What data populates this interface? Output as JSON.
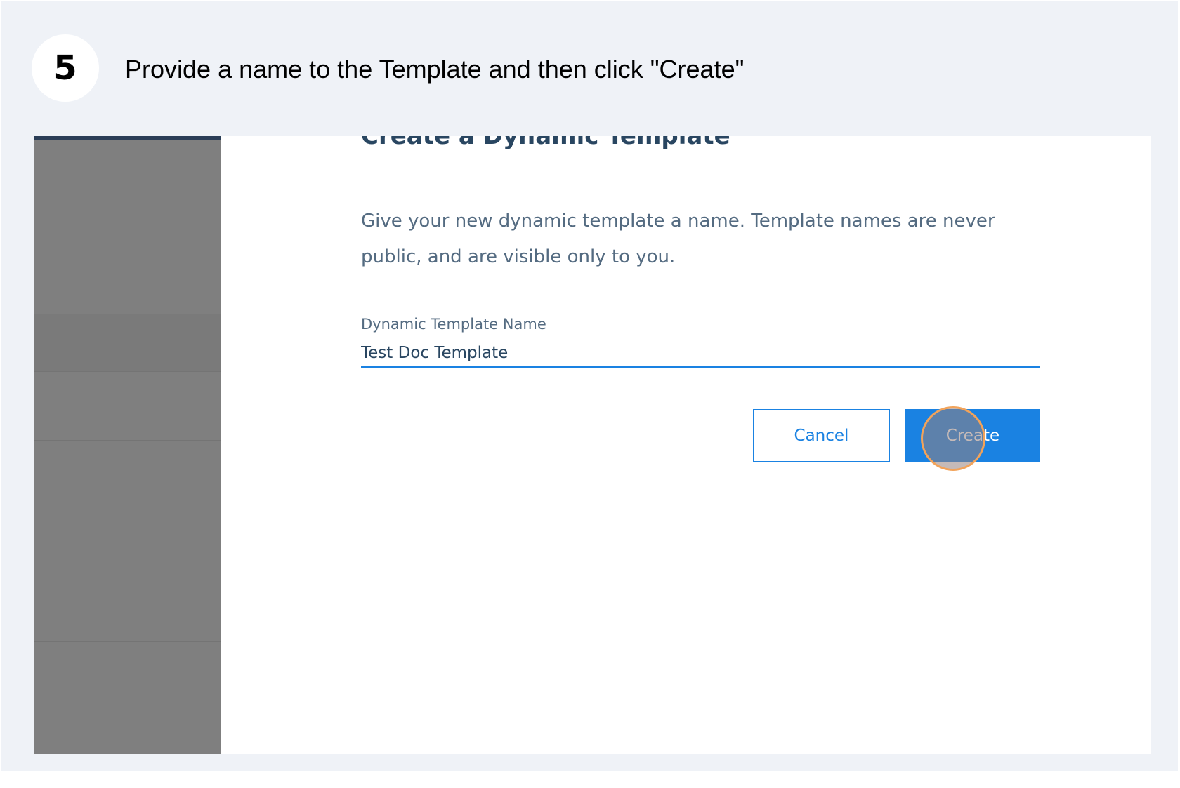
{
  "step": {
    "number": "5",
    "instruction": "Provide a name to the Template and then click \"Create\""
  },
  "dialog": {
    "title": "Create a Dynamic Template",
    "description": "Give your new dynamic template a name. Template names are never public, and are visible only to you.",
    "field_label": "Dynamic Template Name",
    "field_value": "Test Doc Template",
    "cancel_label": "Cancel",
    "create_label": "Create"
  },
  "colors": {
    "accent": "#1a82e2",
    "title_text": "#294661",
    "body_text": "#546b81",
    "click_marker_ring": "#f2a35a",
    "sidebar": "#7f7f7f"
  }
}
